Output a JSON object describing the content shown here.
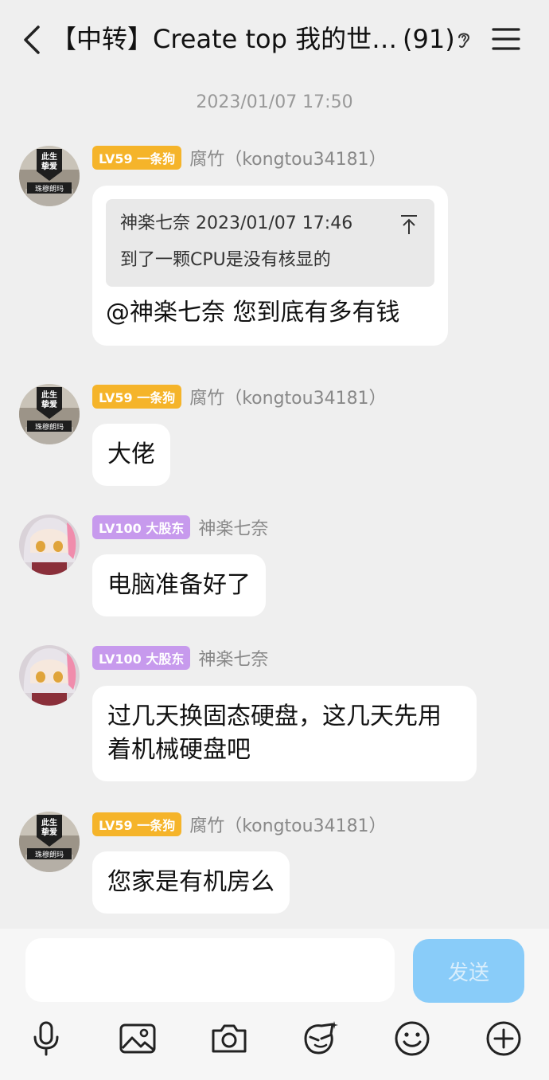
{
  "header": {
    "title": "【中转】Create top 我的世…",
    "count": "(91)"
  },
  "timestamp": "2023/01/07 17:50",
  "messages": [
    {
      "badge": "LV59 一条狗",
      "sender": "腐竹（kongtou34181）",
      "quote": {
        "author_time": "神楽七奈 2023/01/07 17:46",
        "text": "到了一颗CPU是没有核显的"
      },
      "text": "@神楽七奈 您到底有多有钱"
    },
    {
      "badge": "LV59 一条狗",
      "sender": "腐竹（kongtou34181）",
      "text": "大佬"
    },
    {
      "badge": "LV100 大股东",
      "sender": "神楽七奈",
      "text": "电脑准备好了"
    },
    {
      "badge": "LV100 大股东",
      "sender": "神楽七奈",
      "text": "过几天换固态硬盘，这几天先用着机械硬盘吧"
    },
    {
      "badge": "LV59 一条狗",
      "sender": "腐竹（kongtou34181）",
      "text": "您家是有机房么"
    }
  ],
  "input": {
    "send_label": "发送"
  },
  "avatar_text": {
    "line1": "此生",
    "line2": "挚爱",
    "line3": "珠穆朗玛"
  },
  "toolbar": [
    "mic-icon",
    "image-icon",
    "camera-icon",
    "sticker-icon",
    "emoji-icon",
    "plus-icon"
  ],
  "colors": {
    "badge_lv59": "#f5b42a",
    "badge_lv100": "#c79aed",
    "send_button": "#89ccf9"
  }
}
